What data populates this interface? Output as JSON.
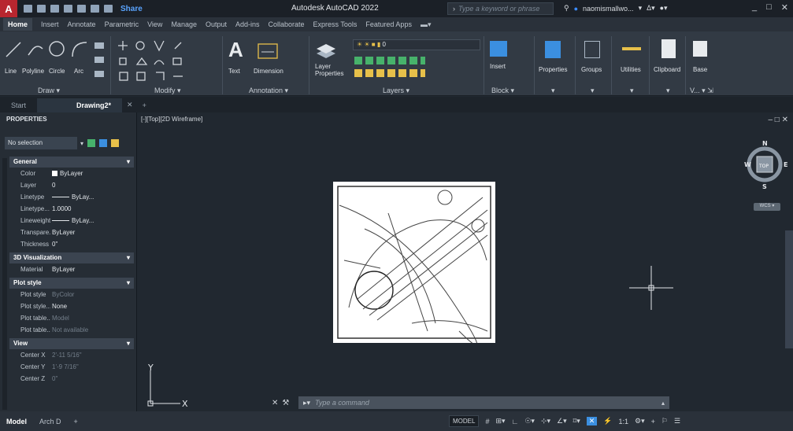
{
  "app": {
    "logo": "A",
    "title": "Autodesk AutoCAD 2022",
    "share": "Share",
    "search_placeholder": "Type a keyword or phrase",
    "user": "naomismallwo...",
    "window_controls": [
      "_",
      "□",
      "✕"
    ]
  },
  "ribbon_tabs": [
    "Home",
    "Insert",
    "Annotate",
    "Parametric",
    "View",
    "Manage",
    "Output",
    "Add-ins",
    "Collaborate",
    "Express Tools",
    "Featured Apps"
  ],
  "ribbon": {
    "draw": {
      "label": "Draw ▾",
      "tools": [
        "Line",
        "Polyline",
        "Circle",
        "Arc"
      ]
    },
    "modify": {
      "label": "Modify ▾"
    },
    "annotation": {
      "label": "Annotation ▾",
      "tools": [
        "Text",
        "Dimension"
      ]
    },
    "layers": {
      "label": "Layers ▾",
      "tool": "Layer Properties",
      "current": "0"
    },
    "block": {
      "label": "Block ▾",
      "tool": "Insert"
    },
    "properties": {
      "label": "Properties"
    },
    "groups": {
      "label": "Groups"
    },
    "utilities": {
      "label": "Utilities"
    },
    "clipboard": {
      "label": "Clipboard"
    },
    "base": {
      "label": "Base",
      "view_label": "V... ▾ ⇲"
    }
  },
  "file_tabs": {
    "start": "Start",
    "drawing": "Drawing2*",
    "close": "✕",
    "add": "+"
  },
  "properties": {
    "title": "PROPERTIES",
    "selection": "No selection",
    "sections": {
      "general": {
        "title": "General",
        "rows": [
          {
            "k": "Color",
            "v": "ByLayer"
          },
          {
            "k": "Layer",
            "v": "0"
          },
          {
            "k": "Linetype",
            "v": "ByLay..."
          },
          {
            "k": "Linetype...",
            "v": "1.0000"
          },
          {
            "k": "Lineweight",
            "v": "ByLay..."
          },
          {
            "k": "Transpare...",
            "v": "ByLayer"
          },
          {
            "k": "Thickness",
            "v": "0\""
          }
        ]
      },
      "viz3d": {
        "title": "3D Visualization",
        "rows": [
          {
            "k": "Material",
            "v": "ByLayer"
          }
        ]
      },
      "plot": {
        "title": "Plot style",
        "rows": [
          {
            "k": "Plot style",
            "v": "ByColor"
          },
          {
            "k": "Plot style...",
            "v": "None"
          },
          {
            "k": "Plot table...",
            "v": "Model"
          },
          {
            "k": "Plot table...",
            "v": "Not available"
          }
        ]
      },
      "view": {
        "title": "View",
        "rows": [
          {
            "k": "Center X",
            "v": "2'-11 5/16\""
          },
          {
            "k": "Center Y",
            "v": "1'-9 7/16\""
          },
          {
            "k": "Center Z",
            "v": "0\""
          }
        ]
      }
    }
  },
  "viewport": {
    "label": "[-][Top][2D Wireframe]",
    "controls": "– □ ✕",
    "compass": {
      "n": "N",
      "s": "S",
      "e": "E",
      "w": "W",
      "face": "TOP"
    },
    "wcs": "WCS ▾",
    "ucs_x": "X",
    "ucs_y": "Y"
  },
  "command": {
    "placeholder": "Type a command"
  },
  "status": {
    "layout_tabs": [
      "Model",
      "Arch D",
      "+"
    ],
    "model_button": "MODEL",
    "scale": "1:1"
  },
  "colors": {
    "accent": "#3b8fe0",
    "logo": "#b8262f"
  }
}
